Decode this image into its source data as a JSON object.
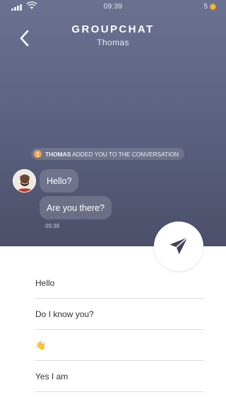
{
  "status_bar": {
    "time": "09:39",
    "coin_count": "5",
    "coin_color": "#f3b63a"
  },
  "header": {
    "back_icon": "chevron-left-icon",
    "title": "GROUPCHAT",
    "subtitle": "Thomas"
  },
  "system_message": {
    "icon": "user-icon",
    "user": "THOMAS",
    "text": "ADDED YOU TO THE CONVERSATION"
  },
  "messages": [
    {
      "text": "Hello?"
    },
    {
      "text": "Are you there?"
    }
  ],
  "message_time": "09:38",
  "send_icon": "paper-plane-icon",
  "replies": [
    {
      "text": "Hello"
    },
    {
      "text": "Do I know you?"
    },
    {
      "text": "👋"
    },
    {
      "text": "Yes I am"
    }
  ],
  "colors": {
    "gradient_top": "#6b7190",
    "gradient_bottom": "#4b4f69",
    "send_icon": "#3f4358",
    "system_icon": "#f0a24a"
  }
}
